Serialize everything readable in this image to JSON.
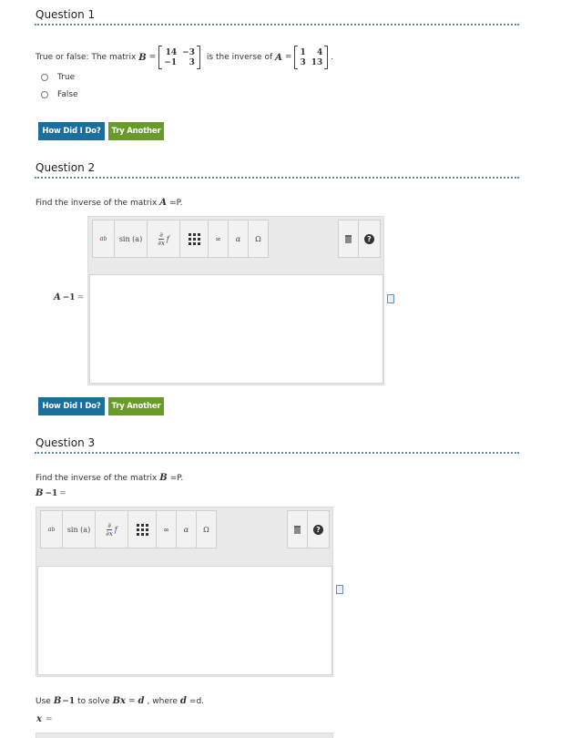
{
  "q1": {
    "title": "Question 1",
    "prompt_a": "True or false: The matrix",
    "b_var": "B",
    "eq": "=",
    "b_matrix": [
      "14",
      "−3",
      "−1",
      "3"
    ],
    "prompt_b": "is the inverse of",
    "a_var": "A",
    "a_matrix": [
      "1",
      "4",
      "3",
      "13"
    ],
    "period": ".",
    "options": [
      "True",
      "False"
    ],
    "check_label": "How Did I Do?",
    "retry_label": "Try Another"
  },
  "q2": {
    "title": "Question 2",
    "prompt": "Find the inverse of the matrix",
    "var": "A",
    "tail": "=P.",
    "answer_label": "A",
    "answer_exp": "−1",
    "answer_eq": "=",
    "check_label": "How Did I Do?",
    "retry_label": "Try Another"
  },
  "q3": {
    "title": "Question 3",
    "prompt": "Find the inverse of the matrix",
    "var": "B",
    "tail": "=P.",
    "label": "B",
    "label_exp": "−1",
    "label_eq": "=",
    "solve_a": "Use",
    "solve_b": "B",
    "solve_exp": "−1",
    "solve_c": "to solve",
    "solve_eq_lhs": "Bx",
    "solve_eq_rhs": "d",
    "solve_where": ", where",
    "solve_d": "d",
    "solve_tail": "=d.",
    "x_label": "x",
    "x_eq": "="
  },
  "toolbar": {
    "power": "a",
    "power_sup": "b",
    "func": "sin (a)",
    "deriv_num": "∂",
    "deriv_den": "∂x",
    "deriv_f": "f",
    "infinity": "∞",
    "alpha": "α",
    "omega": "Ω",
    "help": "?"
  }
}
